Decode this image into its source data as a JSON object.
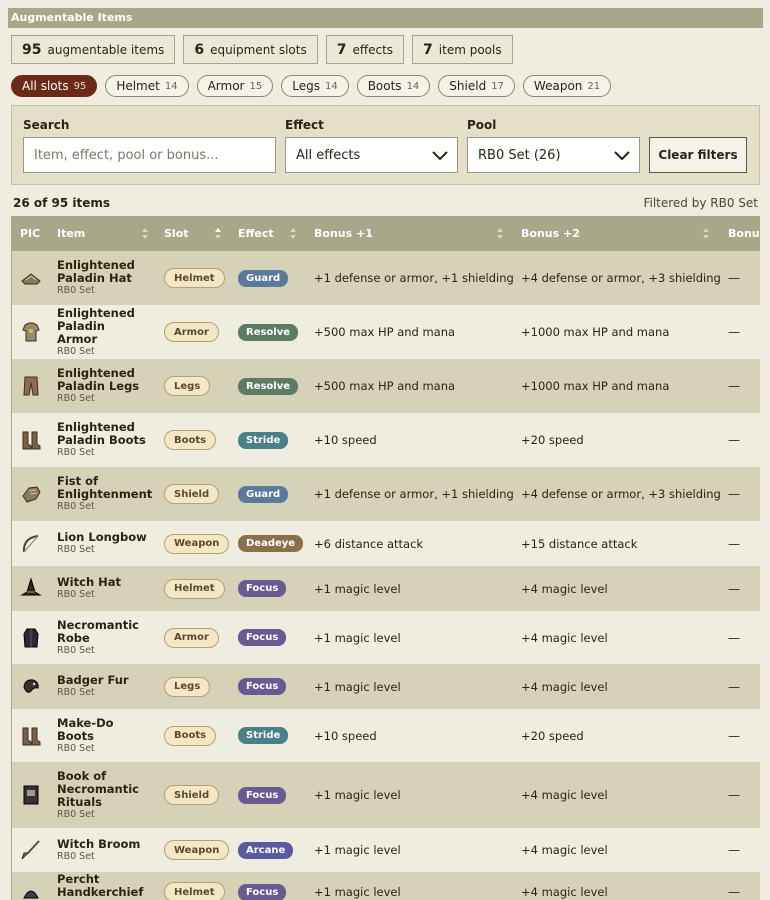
{
  "title": "Augmentable Items",
  "stats": [
    {
      "num": "95",
      "label": "augmentable items"
    },
    {
      "num": "6",
      "label": "equipment slots"
    },
    {
      "num": "7",
      "label": "effects"
    },
    {
      "num": "7",
      "label": "item pools"
    }
  ],
  "slot_filters": [
    {
      "label": "All slots",
      "count": "95",
      "active": true
    },
    {
      "label": "Helmet",
      "count": "14"
    },
    {
      "label": "Armor",
      "count": "15"
    },
    {
      "label": "Legs",
      "count": "14"
    },
    {
      "label": "Boots",
      "count": "14"
    },
    {
      "label": "Shield",
      "count": "17"
    },
    {
      "label": "Weapon",
      "count": "21"
    }
  ],
  "filters": {
    "search_label": "Search",
    "search_placeholder": "Item, effect, pool or bonus...",
    "effect_label": "Effect",
    "effect_value": "All effects",
    "pool_label": "Pool",
    "pool_value": "RB0 Set (26)",
    "clear_label": "Clear filters"
  },
  "result_count": "26 of 95 items",
  "filtered_by": "Filtered by RB0 Set",
  "columns": {
    "pic": "PIC",
    "item": "Item",
    "slot": "Slot",
    "effect": "Effect",
    "bonus1": "Bonus +1",
    "bonus2": "Bonus +2",
    "bonus3": "Bonus"
  },
  "effect_colors": {
    "Guard": "#5a7a9c",
    "Resolve": "#5c7c64",
    "Stride": "#4a8088",
    "Deadeye": "#8a7048",
    "Focus": "#6a5a94",
    "Arcane": "#5a5a9c"
  },
  "rows": [
    {
      "name": "Enlightened Paladin Hat",
      "pool": "RB0 Set",
      "slot": "Helmet",
      "effect": "Guard",
      "bonus1": "+1 defense or armor, +1 shielding",
      "bonus2": "+4 defense or armor, +3 shielding",
      "bonus3": "—",
      "icon": "hat-icon"
    },
    {
      "name": "Enlightened Paladin Armor",
      "pool": "RB0 Set",
      "slot": "Armor",
      "effect": "Resolve",
      "bonus1": "+500 max HP and mana",
      "bonus2": "+1000 max HP and mana",
      "bonus3": "—",
      "icon": "armor-icon"
    },
    {
      "name": "Enlightened Paladin Legs",
      "pool": "RB0 Set",
      "slot": "Legs",
      "effect": "Resolve",
      "bonus1": "+500 max HP and mana",
      "bonus2": "+1000 max HP and mana",
      "bonus3": "—",
      "icon": "legs-icon"
    },
    {
      "name": "Enlightened Paladin Boots",
      "pool": "RB0 Set",
      "slot": "Boots",
      "effect": "Stride",
      "bonus1": "+10 speed",
      "bonus2": "+20 speed",
      "bonus3": "—",
      "icon": "boots-icon"
    },
    {
      "name": "Fist of Enlightenment",
      "pool": "RB0 Set",
      "slot": "Shield",
      "effect": "Guard",
      "bonus1": "+1 defense or armor, +1 shielding",
      "bonus2": "+4 defense or armor, +3 shielding",
      "bonus3": "—",
      "icon": "fist-icon"
    },
    {
      "name": "Lion Longbow",
      "pool": "RB0 Set",
      "slot": "Weapon",
      "effect": "Deadeye",
      "bonus1": "+6 distance attack",
      "bonus2": "+15 distance attack",
      "bonus3": "—",
      "icon": "bow-icon"
    },
    {
      "name": "Witch Hat",
      "pool": "RB0 Set",
      "slot": "Helmet",
      "effect": "Focus",
      "bonus1": "+1 magic level",
      "bonus2": "+4 magic level",
      "bonus3": "—",
      "icon": "witch-hat-icon"
    },
    {
      "name": "Necromantic Robe",
      "pool": "RB0 Set",
      "slot": "Armor",
      "effect": "Focus",
      "bonus1": "+1 magic level",
      "bonus2": "+4 magic level",
      "bonus3": "—",
      "icon": "robe-icon"
    },
    {
      "name": "Badger Fur",
      "pool": "RB0 Set",
      "slot": "Legs",
      "effect": "Focus",
      "bonus1": "+1 magic level",
      "bonus2": "+4 magic level",
      "bonus3": "—",
      "icon": "fur-icon"
    },
    {
      "name": "Make-Do Boots",
      "pool": "RB0 Set",
      "slot": "Boots",
      "effect": "Stride",
      "bonus1": "+10 speed",
      "bonus2": "+20 speed",
      "bonus3": "—",
      "icon": "boots-icon"
    },
    {
      "name": "Book of Necromantic Rituals",
      "pool": "RB0 Set",
      "slot": "Shield",
      "effect": "Focus",
      "bonus1": "+1 magic level",
      "bonus2": "+4 magic level",
      "bonus3": "—",
      "icon": "book-icon"
    },
    {
      "name": "Witch Broom",
      "pool": "RB0 Set",
      "slot": "Weapon",
      "effect": "Arcane",
      "bonus1": "+1 magic level",
      "bonus2": "+4 magic level",
      "bonus3": "—",
      "icon": "broom-icon"
    },
    {
      "name": "Percht Handkerchief",
      "pool": "RB0 Set",
      "slot": "Helmet",
      "effect": "Focus",
      "bonus1": "+1 magic level",
      "bonus2": "+4 magic level",
      "bonus3": "—",
      "icon": "handkerchief-icon"
    }
  ]
}
